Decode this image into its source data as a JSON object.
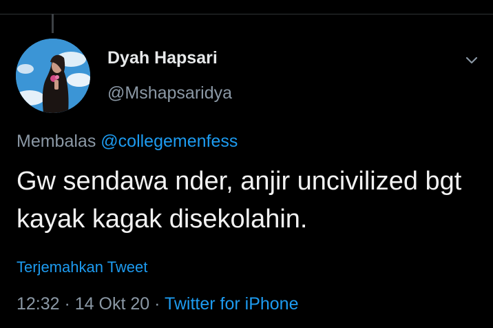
{
  "tweet": {
    "display_name": "Dyah Hapsari",
    "handle": "@Mshapsaridya",
    "reply_prefix": "Membalas",
    "reply_to": "@collegemenfess",
    "text": "Gw sendawa nder, anjir uncivilized bgt kayak kagak disekolahin.",
    "translate_label": "Terjemahkan Tweet",
    "time": "12:32",
    "separator": " · ",
    "date": "14 Okt 20",
    "source": "Twitter for iPhone"
  },
  "icons": {
    "more": "chevron-down-icon",
    "avatar": "profile-photo"
  },
  "colors": {
    "background": "#000000",
    "link": "#1d9bf0",
    "secondary_text": "#8b98a5",
    "primary_text": "#f2f2f2"
  }
}
